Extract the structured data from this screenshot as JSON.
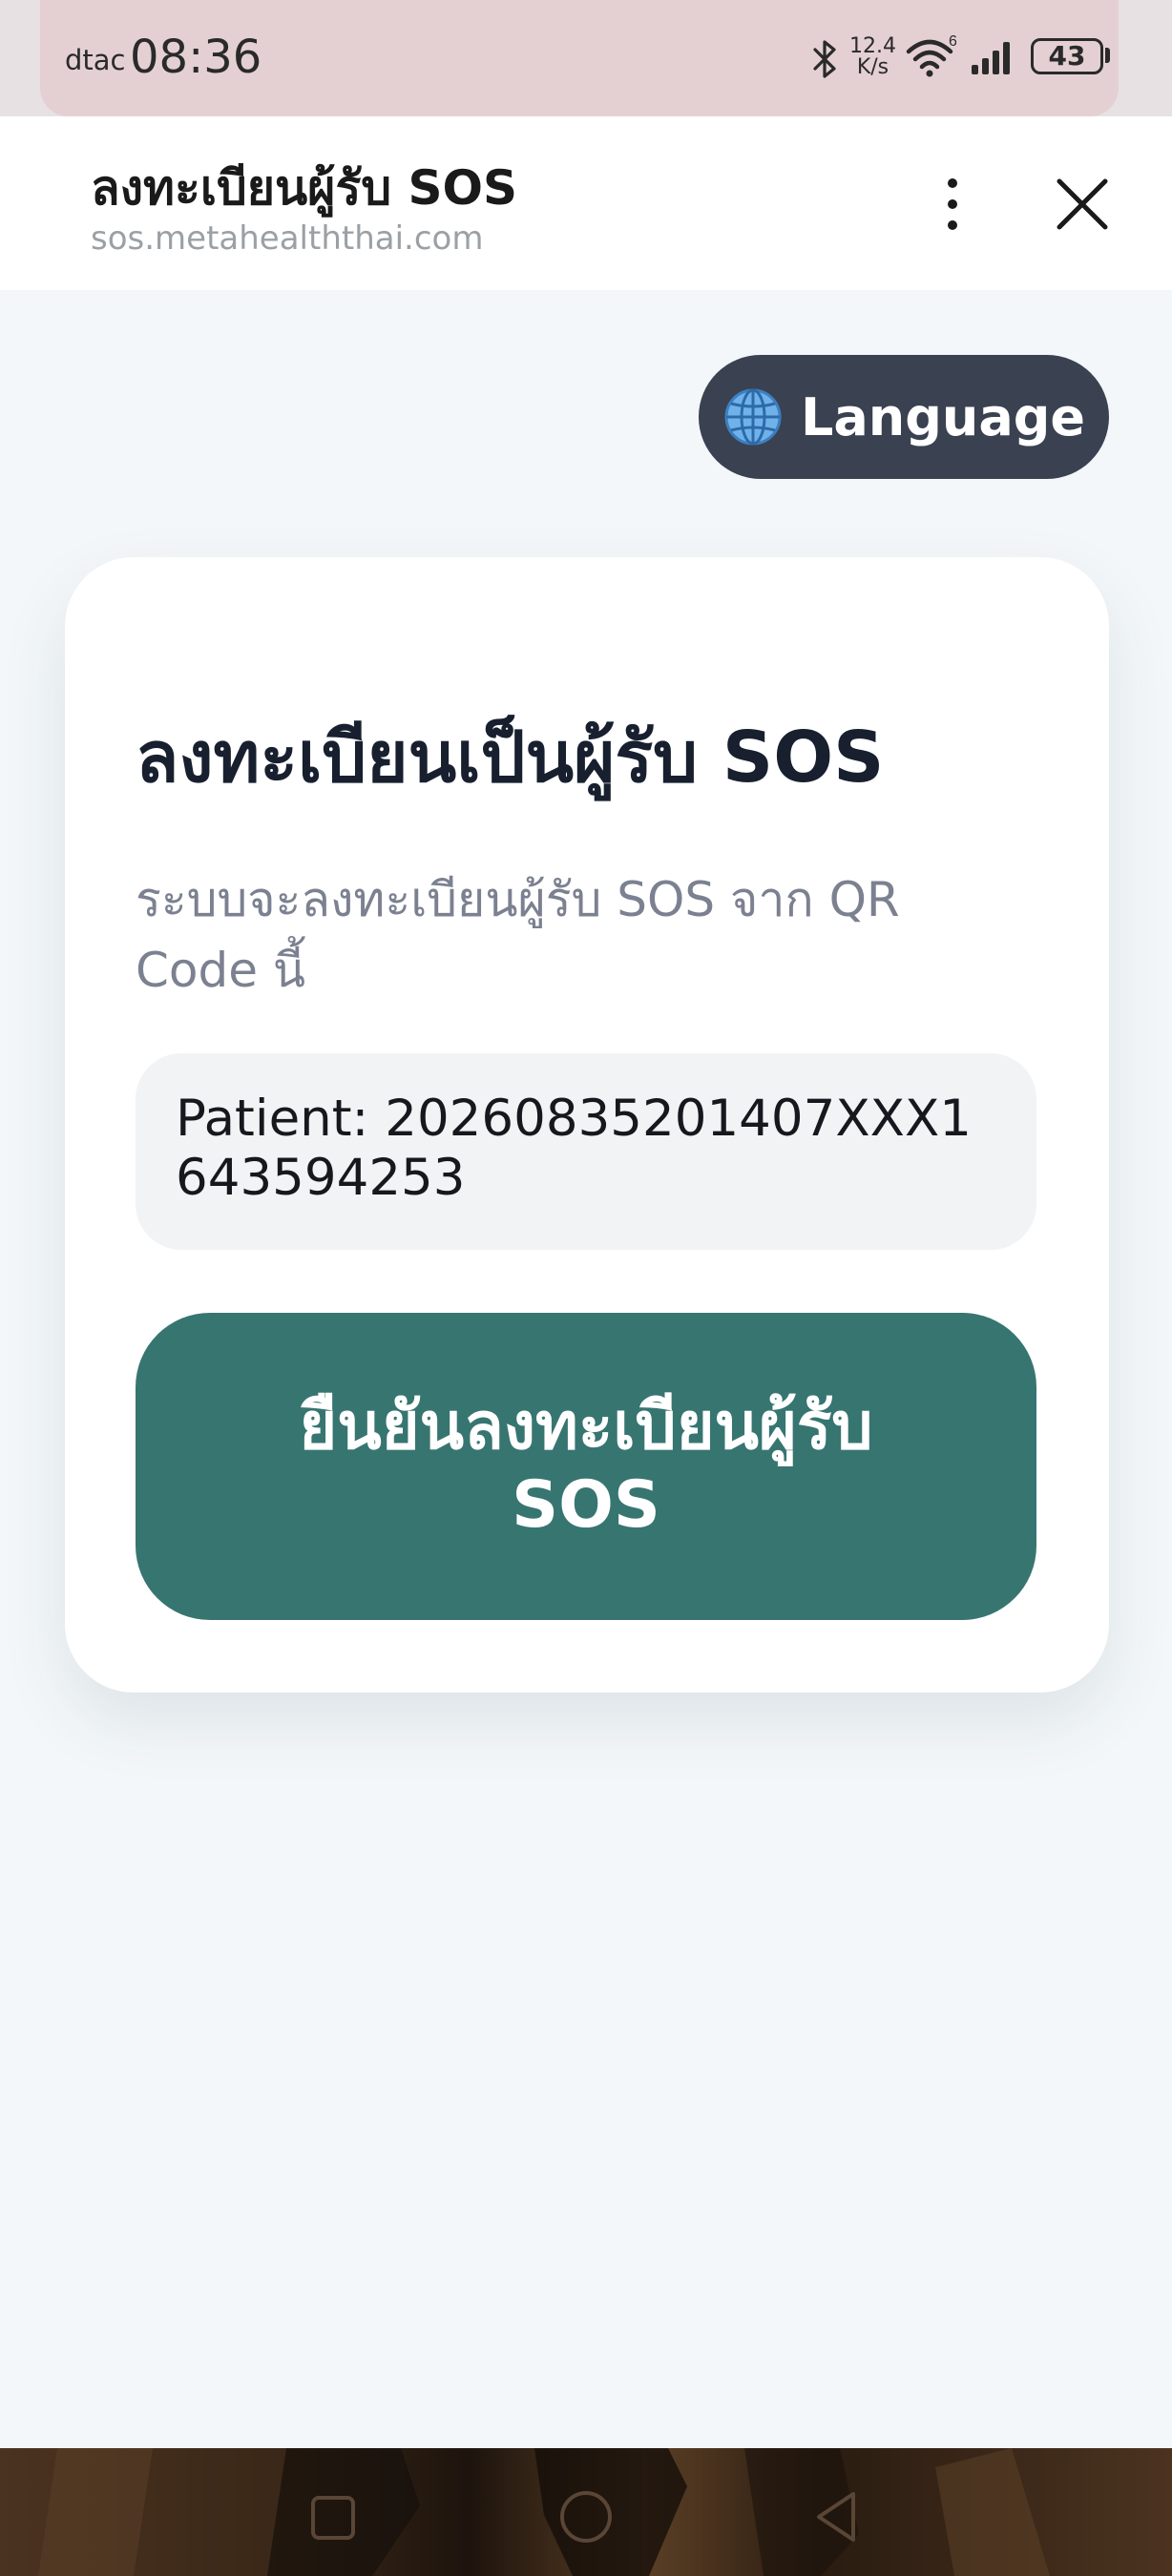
{
  "status_bar": {
    "carrier": "dtac",
    "time": "08:36",
    "net_speed_value": "12.4",
    "net_speed_unit": "K/s",
    "wifi_badge": "6",
    "battery": "43"
  },
  "browser": {
    "title": "ลงทะเบียนผู้รับ SOS",
    "url": "sos.metahealththai.com"
  },
  "language_button": {
    "label": "Language",
    "icon": "globe-icon"
  },
  "card": {
    "title": "ลงทะเบียนเป็นผู้รับ SOS",
    "description": "ระบบจะลงทะเบียนผู้รับ SOS จาก QR Code นี้",
    "patient_label": "Patient: 20260835201407XXX1643594253",
    "confirm_label": "ยืนยันลงทะเบียนผู้รับ SOS"
  },
  "colors": {
    "accent": "#377571",
    "language_bg": "#3a4150",
    "page_bg": "#f3f7f9"
  }
}
